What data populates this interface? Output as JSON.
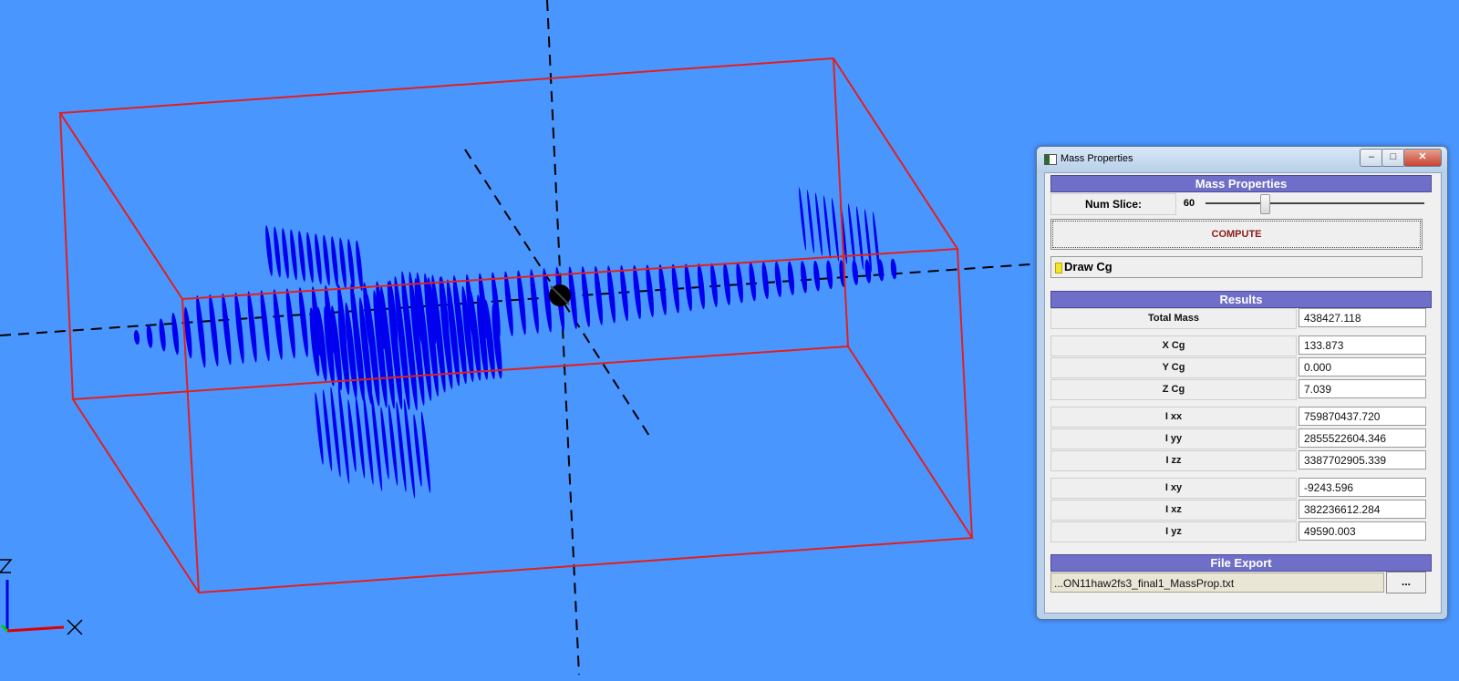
{
  "window": {
    "title": "Mass Properties",
    "min_glyph": "–",
    "max_glyph": "□",
    "close_glyph": "✕"
  },
  "mass_properties": {
    "header": "Mass Properties",
    "num_slice_label": "Num Slice:",
    "num_slice_value": "60",
    "compute_label": "COMPUTE",
    "draw_cg_label": "Draw Cg"
  },
  "results": {
    "header": "Results",
    "rows": [
      {
        "label": "Total Mass",
        "value": "438427.118"
      },
      {
        "label": "X Cg",
        "value": "133.873"
      },
      {
        "label": "Y Cg",
        "value": " 0.000"
      },
      {
        "label": "Z Cg",
        "value": " 7.039"
      },
      {
        "label": "I xx",
        "value": "759870437.720"
      },
      {
        "label": "I yy",
        "value": "2855522604.346"
      },
      {
        "label": "I zz",
        "value": "3387702905.339"
      },
      {
        "label": "I xy",
        "value": "-9243.596"
      },
      {
        "label": "I xz",
        "value": "382236612.284"
      },
      {
        "label": "I yz",
        "value": "49590.003"
      }
    ]
  },
  "file_export": {
    "header": "File Export",
    "file_path": "...ON11haw2fs3_final1_MassProp.txt",
    "browse_label": "..."
  },
  "viewport": {
    "background_color": "#4a96ff",
    "box_color": "#ff2222",
    "slice_color": "#0000ee",
    "axis_color": "#000000"
  }
}
